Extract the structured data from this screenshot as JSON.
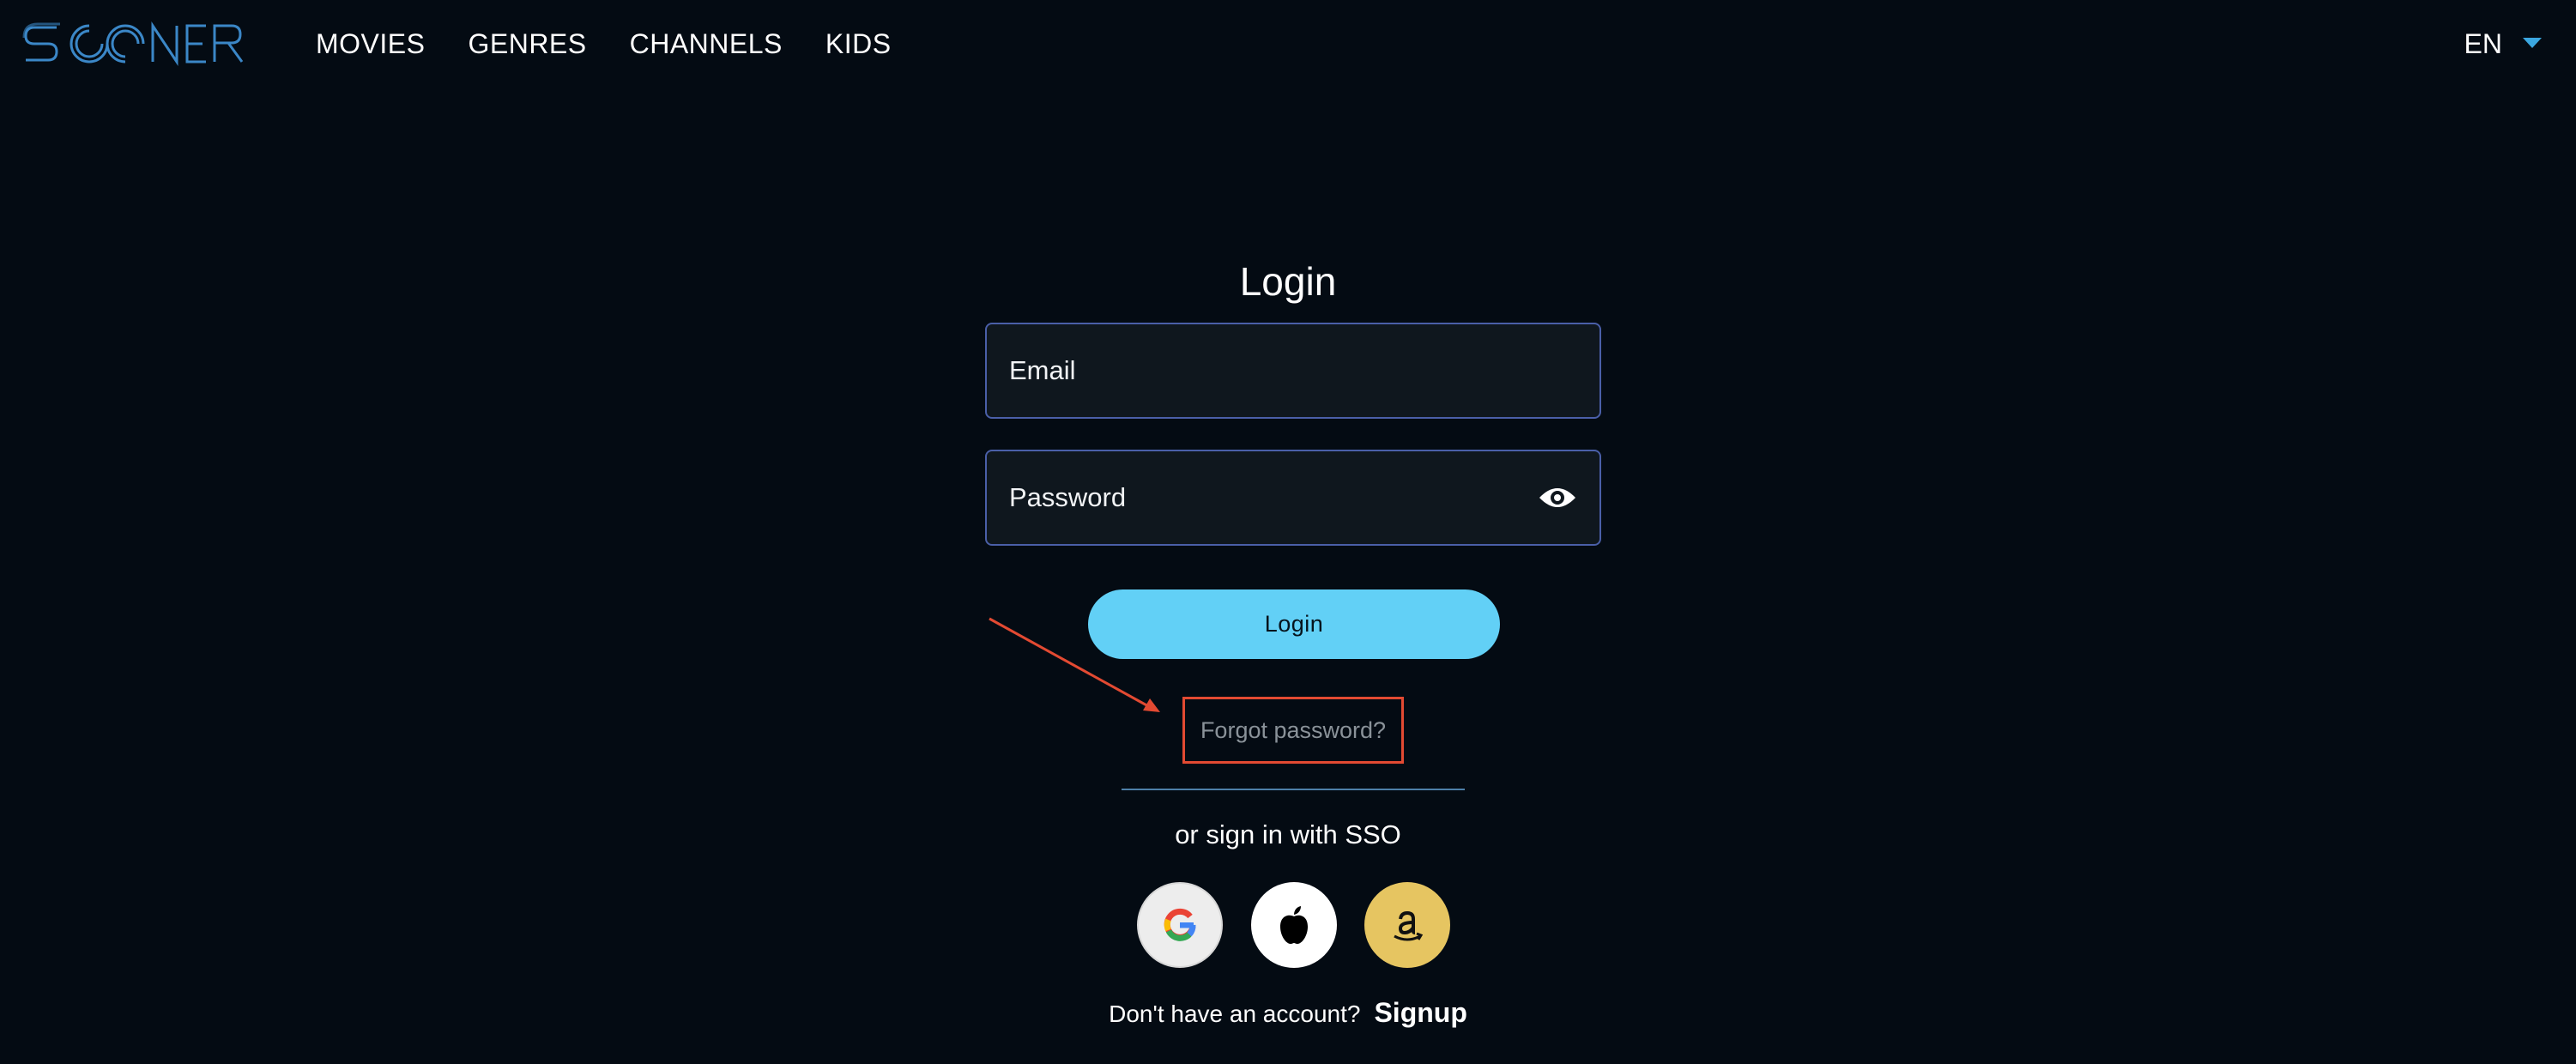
{
  "brand": {
    "logo_text": "SOONER",
    "logo_color": "#3b87c7"
  },
  "nav": {
    "items": [
      {
        "label": "MOVIES"
      },
      {
        "label": "GENRES"
      },
      {
        "label": "CHANNELS"
      },
      {
        "label": "KIDS"
      }
    ]
  },
  "language": {
    "selected": "EN",
    "icon": "chevron-down-icon",
    "caret_color": "#3ba7e0"
  },
  "login": {
    "title": "Login",
    "email": {
      "placeholder": "Email",
      "value": ""
    },
    "password": {
      "placeholder": "Password",
      "value": "",
      "toggle_icon": "eye-icon"
    },
    "submit_label": "Login",
    "forgot_label": "Forgot password?",
    "sso_label": "or sign in with SSO",
    "sso_providers": [
      {
        "name": "Google",
        "icon": "google-icon"
      },
      {
        "name": "Apple",
        "icon": "apple-icon"
      },
      {
        "name": "Amazon",
        "icon": "amazon-icon"
      }
    ],
    "signup_prompt": "Don't have an account?",
    "signup_label": "Signup"
  },
  "annotation": {
    "color": "#e34a32",
    "target": "forgot-password-link"
  },
  "colors": {
    "background": "#040b13",
    "field_background": "#0f171e",
    "field_border": "#4a5fa8",
    "accent": "#62d0f6",
    "divider": "#4d7fa8"
  }
}
